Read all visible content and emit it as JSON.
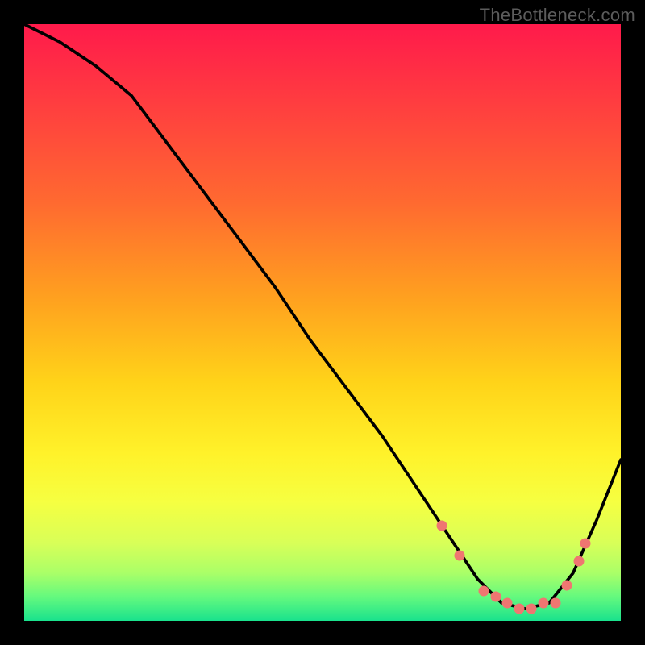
{
  "watermark": "TheBottleneck.com",
  "chart_data": {
    "type": "line",
    "title": "",
    "xlabel": "",
    "ylabel": "",
    "xlim": [
      0,
      100
    ],
    "ylim": [
      0,
      100
    ],
    "grid": false,
    "series": [
      {
        "name": "bottleneck-curve",
        "x": [
          0,
          6,
          12,
          18,
          24,
          30,
          36,
          42,
          48,
          54,
          60,
          66,
          72,
          76,
          80,
          84,
          88,
          92,
          96,
          100
        ],
        "y": [
          100,
          97,
          93,
          88,
          80,
          72,
          64,
          56,
          47,
          39,
          31,
          22,
          13,
          7,
          3,
          2,
          3,
          8,
          17,
          27
        ]
      }
    ],
    "highlight_points": {
      "name": "sweet-spot-dots",
      "x": [
        70,
        73,
        77,
        79,
        81,
        83,
        85,
        87,
        89,
        91,
        93,
        94
      ],
      "y": [
        16,
        11,
        5,
        4,
        3,
        2,
        2,
        3,
        3,
        6,
        10,
        13
      ]
    },
    "background_gradient_stops": [
      {
        "pos": 0.0,
        "color": "#ff1a4b"
      },
      {
        "pos": 0.14,
        "color": "#ff3f3f"
      },
      {
        "pos": 0.3,
        "color": "#ff6a30"
      },
      {
        "pos": 0.46,
        "color": "#ffa11f"
      },
      {
        "pos": 0.6,
        "color": "#ffd319"
      },
      {
        "pos": 0.72,
        "color": "#fff22a"
      },
      {
        "pos": 0.8,
        "color": "#f6ff41"
      },
      {
        "pos": 0.87,
        "color": "#d8ff58"
      },
      {
        "pos": 0.92,
        "color": "#aaff68"
      },
      {
        "pos": 0.96,
        "color": "#64f97e"
      },
      {
        "pos": 1.0,
        "color": "#19e28d"
      }
    ]
  }
}
